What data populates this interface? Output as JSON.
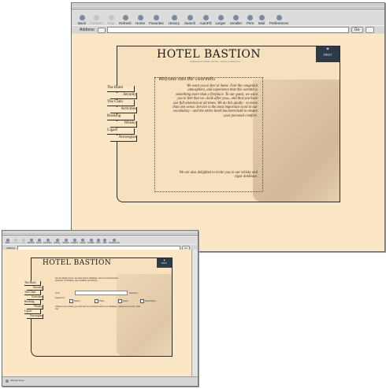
{
  "toolbar": {
    "buttons": [
      {
        "label": "Back",
        "icon": "back-arrow-icon"
      },
      {
        "label": "Forward",
        "icon": "forward-arrow-icon"
      },
      {
        "label": "Stop",
        "icon": "stop-icon"
      },
      {
        "label": "Refresh",
        "icon": "refresh-icon"
      },
      {
        "label": "Home",
        "icon": "home-icon"
      },
      {
        "label": "Favorites",
        "icon": "favorites-icon"
      },
      {
        "label": "History",
        "icon": "history-icon"
      },
      {
        "label": "Search",
        "icon": "search-icon"
      },
      {
        "label": "AutoFill",
        "icon": "autofill-icon"
      },
      {
        "label": "Larger",
        "icon": "larger-text-icon"
      },
      {
        "label": "Smaller",
        "icon": "smaller-text-icon"
      },
      {
        "label": "Print",
        "icon": "print-icon"
      },
      {
        "label": "Mail",
        "icon": "mail-icon"
      },
      {
        "label": "Preferences",
        "icon": "preferences-icon"
      }
    ]
  },
  "address": {
    "label": "Address:",
    "value": "",
    "go": "Go"
  },
  "site": {
    "logo": "HOTEL BASTION",
    "logo_sub": "GÖTEBORGS SVENSKA HOTELL · ÖSTRA HAMNGATAN",
    "badge": "FIRST",
    "nav": [
      "The Hotel",
      "Security",
      "The Clain",
      "Activities",
      "Booking",
      "Whisky",
      "Cigars",
      "Norwegian"
    ],
    "welcome_title": "Welcome into the «warmth»",
    "welcome_text": "We want you to feel at home. Feel the congenial atmosphere, and experience that this warmth is something more than a fireplace. To our guest, we want you to feel that we «look after you», and that you have our full attention at all times. We do this gladly - to move than one sense. Service is the most important word in our vocabulary - and the entire hotel has been built to ensure your personal comfort.",
    "welcome_footer": "We are also delighted to invite you to our whisky and cigar database."
  },
  "search_page": {
    "intro": "For all whisky lovers, we have built a database, with a comprehensive selection of whiskies, their qualities and history.",
    "text_label": "Text:",
    "search_button": "[Search]",
    "search_in_label": "Search in:",
    "options": [
      "Name",
      "Price",
      "Taste",
      "Description"
    ],
    "note": "If there is any whisky you feel that we should include in our database, please let us know. [Tips Us]"
  },
  "status": {
    "text": "Internet zone"
  },
  "colors": {
    "page": "#fbe6c5",
    "panel": "#f6e0bd",
    "chrome": "#d9d9d9",
    "badge": "#2d3a4a"
  }
}
